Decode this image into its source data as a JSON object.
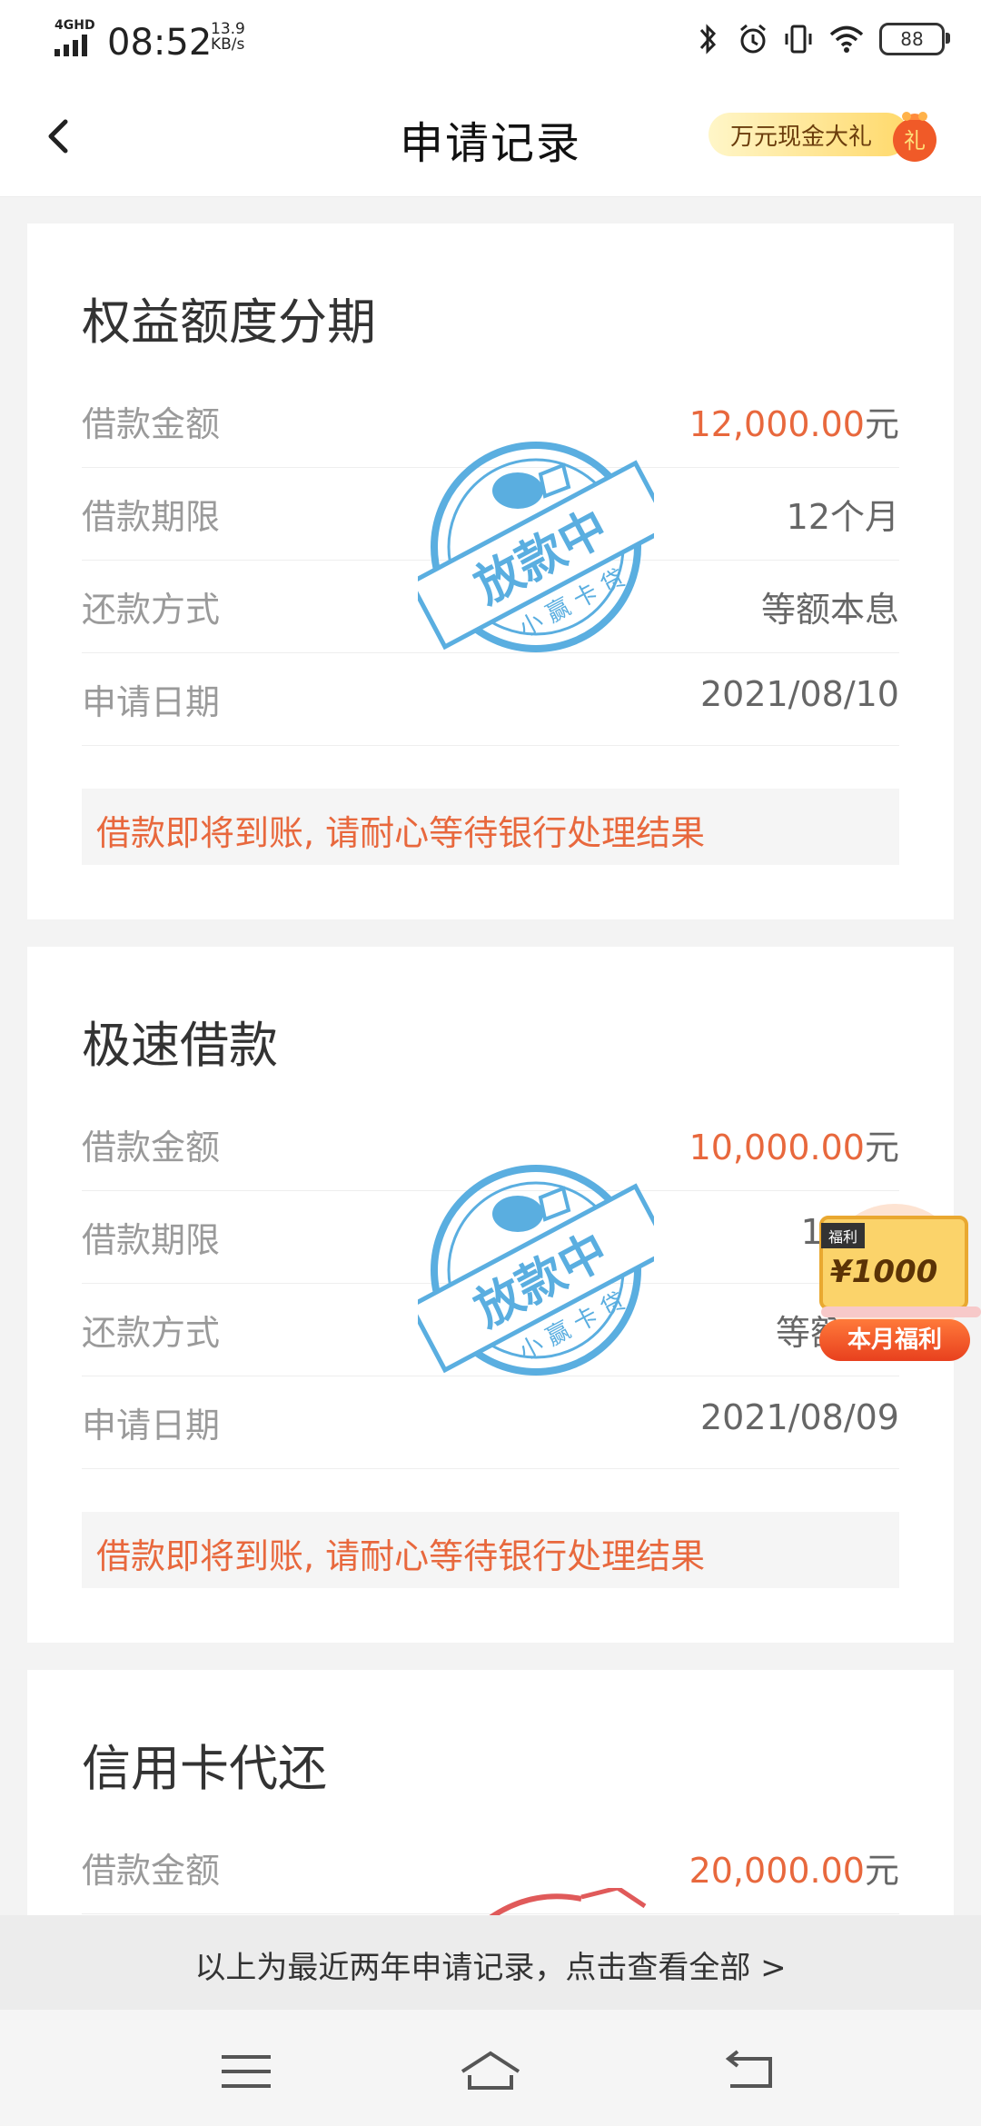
{
  "status_bar": {
    "network": "4GHD",
    "time": "08:52",
    "speed_value": "13.9",
    "speed_unit": "KB/s",
    "battery": "88",
    "icons": [
      "bluetooth-icon",
      "alarm-icon",
      "vibrate-icon",
      "wifi-icon",
      "battery-icon"
    ]
  },
  "header": {
    "title": "申请记录",
    "promo_label": "万元现金大礼",
    "promo_badge": "礼"
  },
  "cards": [
    {
      "title": "权益额度分期",
      "rows": [
        {
          "label": "借款金额",
          "value": "12,000.00",
          "unit": "元"
        },
        {
          "label": "借款期限",
          "value": "12个月"
        },
        {
          "label": "还款方式",
          "value": "等额本息"
        },
        {
          "label": "申请日期",
          "value": "2021/08/10"
        }
      ],
      "notice": "借款即将到账, 请耐心等待银行处理结果",
      "stamp": {
        "main": "放款中",
        "sub": "小赢卡贷"
      }
    },
    {
      "title": "极速借款",
      "rows": [
        {
          "label": "借款金额",
          "value": "10,000.00",
          "unit": "元"
        },
        {
          "label": "借款期限",
          "value": "12"
        },
        {
          "label": "还款方式",
          "value": "等额"
        },
        {
          "label": "申请日期",
          "value": "2021/08/09"
        }
      ],
      "notice": "借款即将到账, 请耐心等待银行处理结果",
      "stamp": {
        "main": "放款中",
        "sub": "小赢卡贷"
      }
    },
    {
      "title": "信用卡代还",
      "rows": [
        {
          "label": "借款金额",
          "value": "20,000.00",
          "unit": "元"
        }
      ]
    }
  ],
  "reward": {
    "tag": "福利",
    "amount": "¥1000",
    "button": "本月福利"
  },
  "footer_tip": "以上为最近两年申请记录，点击查看全部 >",
  "navbar": {
    "icons": [
      "menu-icon",
      "home-icon",
      "back-nav-icon"
    ]
  },
  "colors": {
    "accent": "#e8683d",
    "stamp_blue": "#5aaee0",
    "stamp_red": "#e05a5a"
  }
}
